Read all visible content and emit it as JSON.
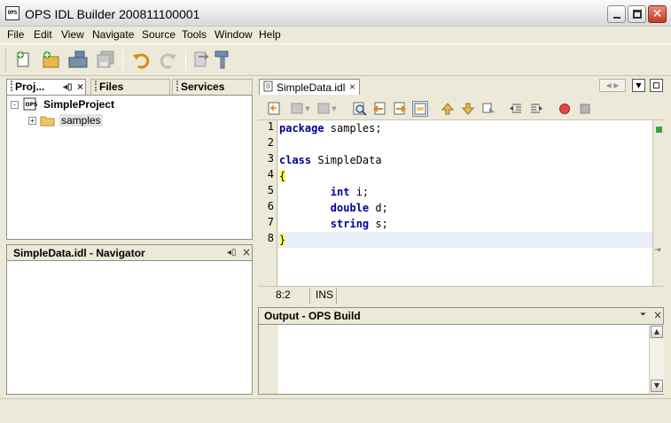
{
  "window": {
    "title": "OPS IDL Builder  200811100001",
    "app_icon_label": "OPS",
    "close_glyph": "✕"
  },
  "menu": [
    "File",
    "Edit",
    "View",
    "Navigate",
    "Source",
    "Tools",
    "Window",
    "Help"
  ],
  "projects_panel": {
    "tabs": [
      {
        "label": "Proj...",
        "active": true
      },
      {
        "label": "Files",
        "active": false
      },
      {
        "label": "Services",
        "active": false
      }
    ],
    "tree": [
      {
        "label": "SimpleProject",
        "level": 0,
        "expander": "-",
        "icon": "project-icon"
      },
      {
        "label": "samples",
        "level": 1,
        "expander": "+",
        "icon": "folder-icon"
      }
    ]
  },
  "navigator_panel": {
    "title": "SimpleData.idl - Navigator"
  },
  "editor": {
    "tab_label": "SimpleData.idl",
    "lines": [
      {
        "num": "1",
        "tokens": [
          {
            "t": "package",
            "kw": true
          },
          {
            "t": " samples;",
            "kw": false
          }
        ]
      },
      {
        "num": "2",
        "tokens": []
      },
      {
        "num": "3",
        "tokens": [
          {
            "t": "class",
            "kw": true
          },
          {
            "t": " SimpleData",
            "kw": false
          }
        ]
      },
      {
        "num": "4",
        "tokens": [
          {
            "t": "{",
            "brace": true
          }
        ]
      },
      {
        "num": "5",
        "tokens": [
          {
            "t": "        ",
            "kw": false
          },
          {
            "t": "int",
            "kw": true
          },
          {
            "t": " i;",
            "kw": false
          }
        ]
      },
      {
        "num": "6",
        "tokens": [
          {
            "t": "        ",
            "kw": false
          },
          {
            "t": "double",
            "kw": true
          },
          {
            "t": " d;",
            "kw": false
          }
        ]
      },
      {
        "num": "7",
        "tokens": [
          {
            "t": "        ",
            "kw": false
          },
          {
            "t": "string",
            "kw": true
          },
          {
            "t": " s;",
            "kw": false
          }
        ]
      },
      {
        "num": "8",
        "tokens": [
          {
            "t": "}",
            "brace": true
          }
        ]
      }
    ],
    "cursor_position": "8:2",
    "insert_mode": "INS"
  },
  "output_panel": {
    "title": "Output - OPS Build"
  }
}
